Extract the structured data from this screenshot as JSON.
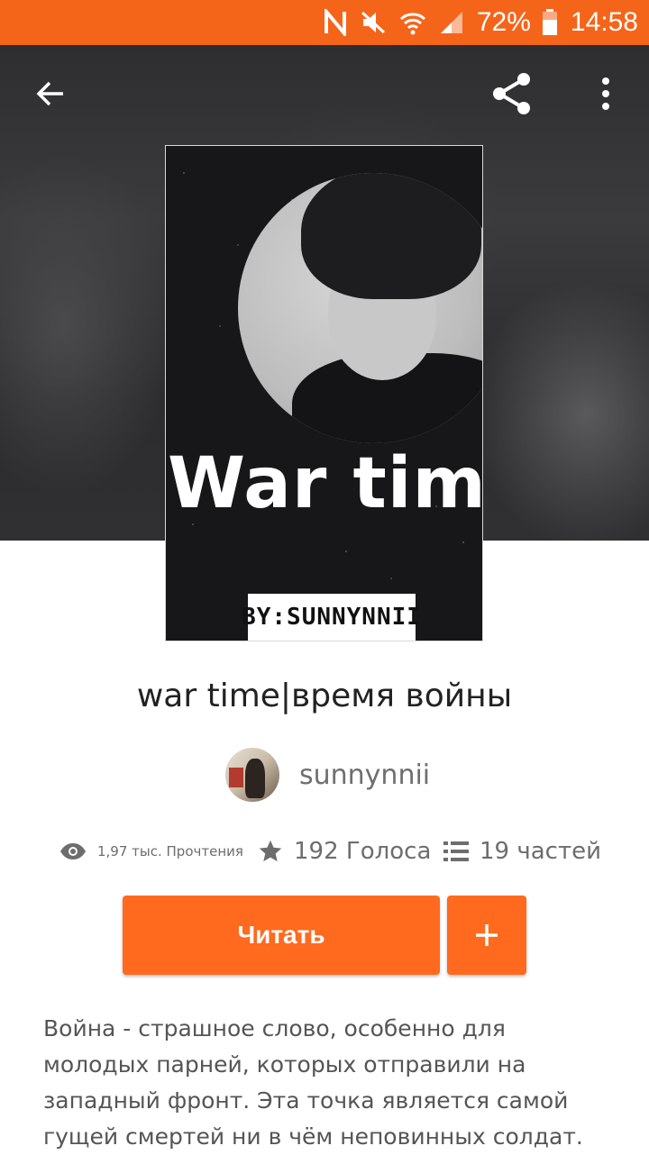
{
  "status_bar": {
    "battery": "72%",
    "time": "14:58",
    "bg_color": "#f4651a",
    "icons": [
      "nfc-icon",
      "mute-icon",
      "wifi-icon",
      "signal-icon",
      "battery-icon"
    ]
  },
  "toolbar": {
    "back_icon": "arrow-left-icon",
    "share_icon": "share-icon",
    "more_icon": "more-vertical-icon"
  },
  "cover": {
    "title": "War time",
    "byline": "BY:SUNNYNNII"
  },
  "story": {
    "title": "war time|время войны",
    "author": "sunnynnii"
  },
  "stats": {
    "reads": "1,97 тыс. Прочтения",
    "votes": "192 Голоса",
    "parts": "19 частей"
  },
  "actions": {
    "read_label": "Читать",
    "add_label": "+",
    "accent_color": "#ff6a1e"
  },
  "description": {
    "lines": [
      "Война - страшное слово, особенно для",
      "молодых парней, которых отправили на",
      "западный фронт. Эта точка является самой",
      "гущей смертей ни в чём неповинных солдат."
    ]
  }
}
